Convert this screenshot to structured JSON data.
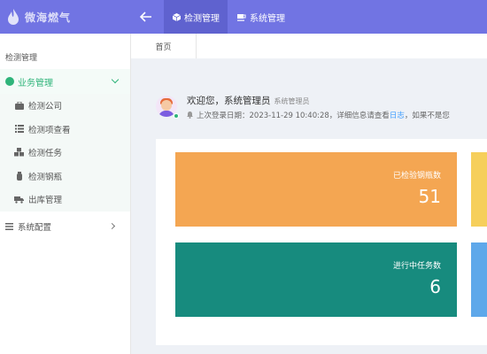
{
  "header": {
    "logo_text": "微海燃气",
    "nav": [
      {
        "label": "检测管理",
        "icon": "cube-icon",
        "active": true
      },
      {
        "label": "系统管理",
        "icon": "cup-icon",
        "active": false
      }
    ]
  },
  "sidebar": {
    "group_title": "检测管理",
    "menu": {
      "label": "业务管理",
      "icon": "globe-icon"
    },
    "items": [
      {
        "label": "检测公司",
        "icon": "briefcase-icon"
      },
      {
        "label": "检测项查看",
        "icon": "list-icon"
      },
      {
        "label": "检测任务",
        "icon": "cubes-icon"
      },
      {
        "label": "检测钢瓶",
        "icon": "cylinder-icon"
      },
      {
        "label": "出库管理",
        "icon": "truck-icon"
      }
    ],
    "config": {
      "label": "系统配置",
      "icon": "menu-icon"
    }
  },
  "tabs": [
    {
      "label": "首页"
    }
  ],
  "welcome": {
    "greeting": "欢迎您，系统管理员",
    "role": "系统管理员",
    "login_prefix": "上次登录日期：",
    "login_date": "2023-11-29 10:40:28",
    "login_middle": "，详细信息请查看",
    "log_link": "日志",
    "login_suffix": "，如果不是您"
  },
  "stats": [
    {
      "label": "已检验钢瓶数",
      "value": "51",
      "color": "#f4a652"
    },
    {
      "label": "进行中任务数",
      "value": "6",
      "color": "#178b7e"
    }
  ],
  "colors": {
    "header": "#7174e3",
    "header_active": "#5f62cf",
    "accent_green": "#2fb47a",
    "link": "#409eff",
    "card_yellow": "#f6cf5b",
    "card_blue": "#5ea8ea"
  }
}
